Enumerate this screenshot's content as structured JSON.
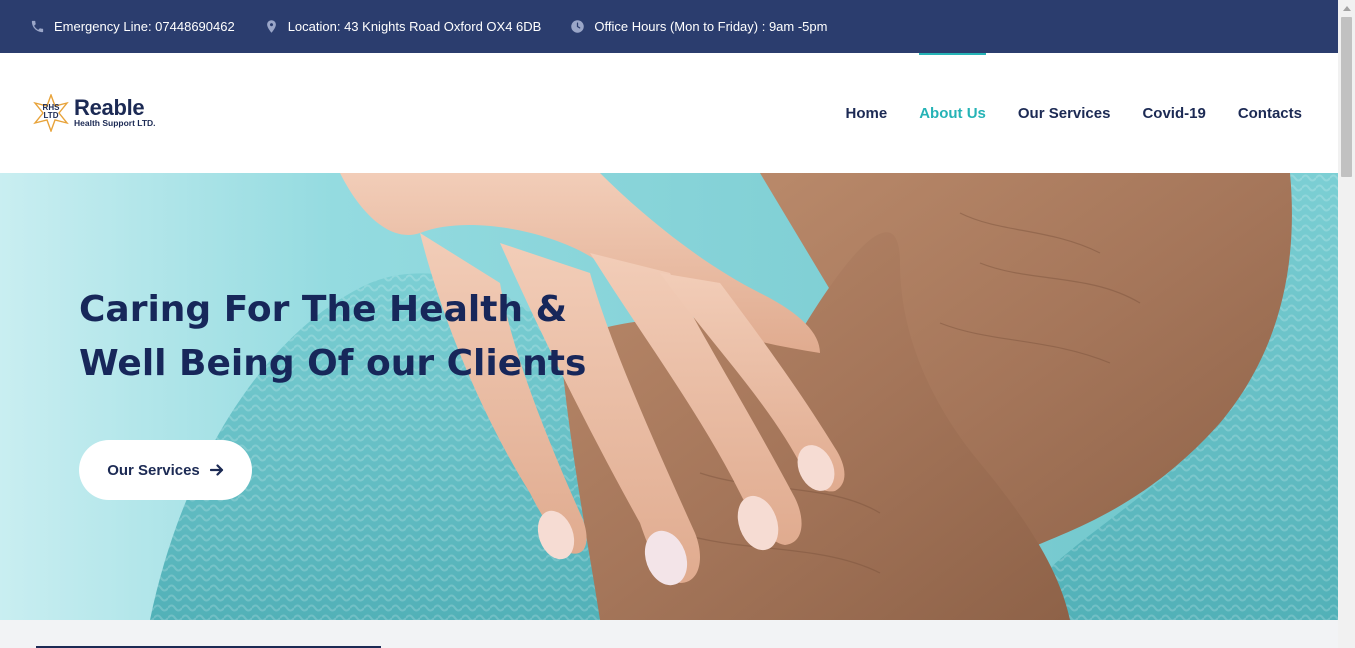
{
  "topbar": {
    "emergency": "Emergency Line: 07448690462",
    "location": "Location: 43 Knights Road Oxford OX4 6DB",
    "hours": "Office Hours (Mon to Friday) : 9am -5pm"
  },
  "logo": {
    "badge_line1": "RHS",
    "badge_line2": "LTD",
    "name": "Reable",
    "subtitle": "Health Support LTD."
  },
  "nav": {
    "items": [
      {
        "label": "Home",
        "active": false
      },
      {
        "label": "About Us",
        "active": true
      },
      {
        "label": "Our Services",
        "active": false
      },
      {
        "label": "Covid-19",
        "active": false
      },
      {
        "label": "Contacts",
        "active": false
      }
    ]
  },
  "hero": {
    "title_line1": "Caring For The Health &",
    "title_line2": "Well Being Of our Clients",
    "button_label": "Our Services"
  },
  "colors": {
    "topbar_bg": "#2b3d6e",
    "navy": "#1c2a54",
    "accent": "#25b3b6",
    "teal_sweater": "#6cc4c9"
  },
  "icons": [
    "phone-icon",
    "location-pin-icon",
    "clock-icon",
    "arrow-right-icon",
    "star-badge-icon"
  ]
}
